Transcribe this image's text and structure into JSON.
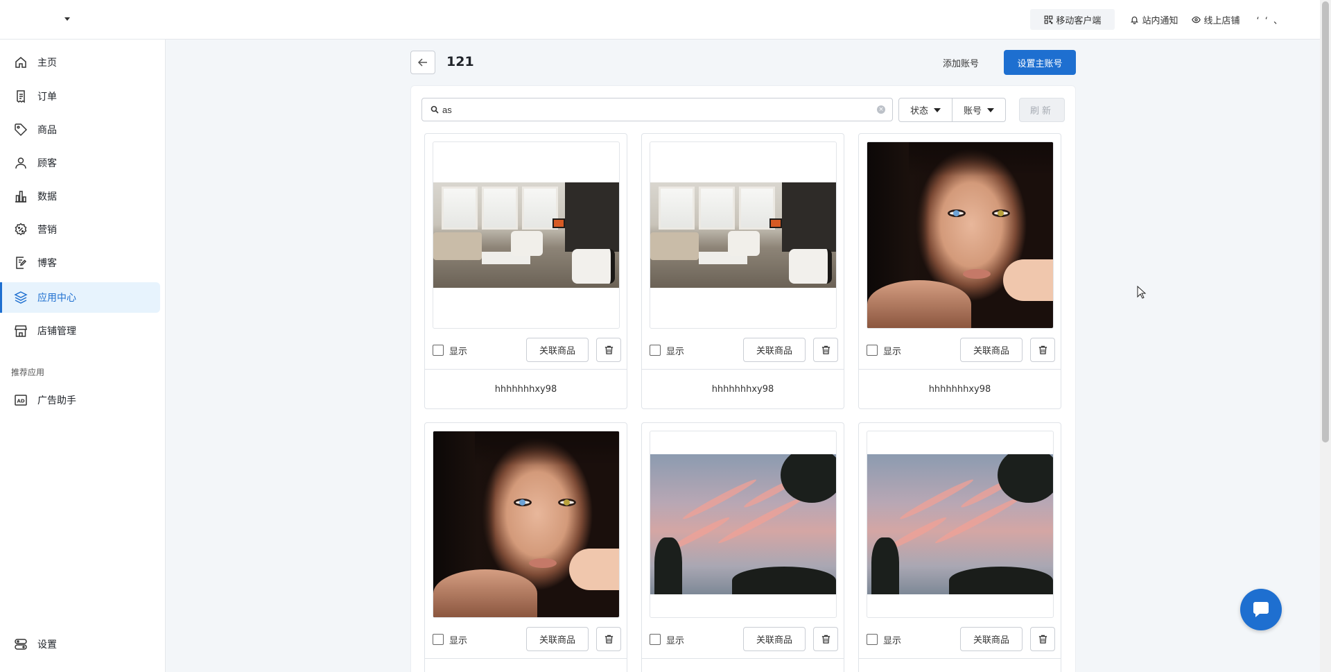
{
  "topbar": {
    "store_name": "",
    "mobile_client": "移动客户端",
    "notifications": "站内通知",
    "online_store": "线上店铺",
    "user_name": "ʻ ʻ 、"
  },
  "sidebar": {
    "items": [
      {
        "label": "主页",
        "icon": "home-icon"
      },
      {
        "label": "订单",
        "icon": "receipt-icon"
      },
      {
        "label": "商品",
        "icon": "tag-icon"
      },
      {
        "label": "顾客",
        "icon": "user-icon"
      },
      {
        "label": "数据",
        "icon": "bar-chart-icon"
      },
      {
        "label": "营销",
        "icon": "discount-icon"
      },
      {
        "label": "博客",
        "icon": "edit-note-icon"
      },
      {
        "label": "应用中心",
        "icon": "layers-icon",
        "active": true
      },
      {
        "label": "店铺管理",
        "icon": "store-icon"
      }
    ],
    "section_title": "推荐应用",
    "recommended": [
      {
        "label": "广告助手",
        "icon": "ad-icon"
      }
    ],
    "settings": {
      "label": "设置",
      "icon": "settings-icon"
    }
  },
  "header": {
    "title": "121",
    "add_account": "添加账号",
    "set_main_account": "设置主账号"
  },
  "toolbar": {
    "search_value": "as",
    "status_filter": "状态",
    "account_filter": "账号",
    "refresh": "刷新"
  },
  "cards": [
    {
      "image": "living-room",
      "show_label": "显示",
      "link_label": "关联商品",
      "account": "hhhhhhhxy98"
    },
    {
      "image": "living-room",
      "show_label": "显示",
      "link_label": "关联商品",
      "account": "hhhhhhhxy98"
    },
    {
      "image": "portrait",
      "show_label": "显示",
      "link_label": "关联商品",
      "account": "hhhhhhhxy98"
    },
    {
      "image": "portrait",
      "show_label": "显示",
      "link_label": "关联商品",
      "account": ""
    },
    {
      "image": "sky",
      "show_label": "显示",
      "link_label": "关联商品",
      "account": ""
    },
    {
      "image": "sky",
      "show_label": "显示",
      "link_label": "关联商品",
      "account": ""
    }
  ],
  "colors": {
    "primary": "#1e6fd0",
    "active_bg": "#e7f3fd",
    "page_bg": "#f3f6f9"
  }
}
